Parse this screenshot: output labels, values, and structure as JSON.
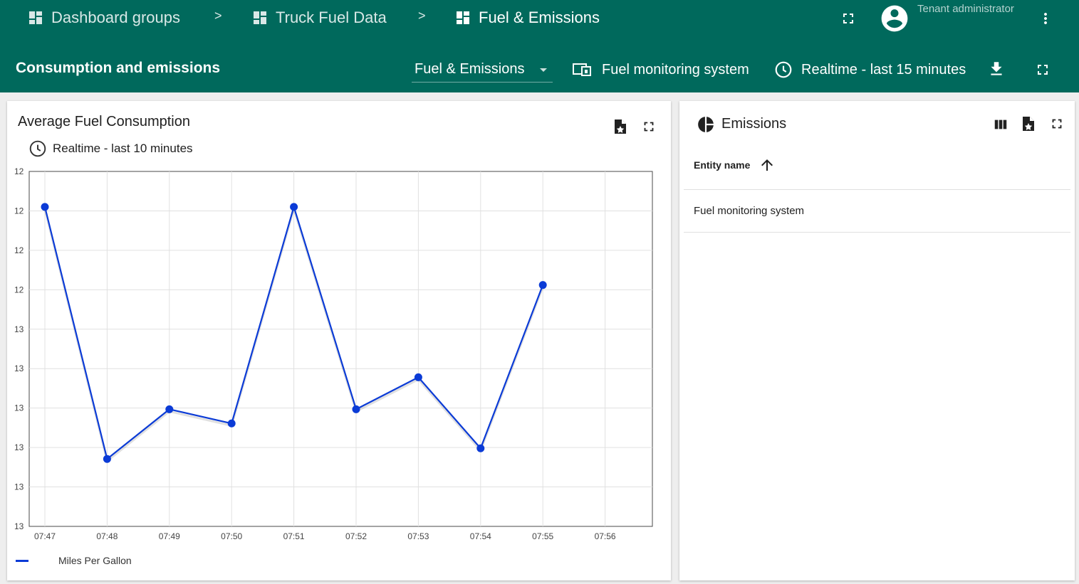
{
  "breadcrumbs": [
    {
      "label": "Dashboard groups"
    },
    {
      "label": "Truck Fuel Data"
    },
    {
      "label": "Fuel & Emissions"
    }
  ],
  "breadcrumb_separator": ">",
  "user": {
    "role": "Tenant administrator"
  },
  "dashboard": {
    "title": "Consumption and emissions",
    "state_select": "Fuel & Emissions",
    "entity_alias": "Fuel monitoring system",
    "timewindow": "Realtime - last 15 minutes"
  },
  "colors": {
    "header": "#00695c",
    "series": "#0b3bd6"
  },
  "widgets": {
    "fuel": {
      "title": "Average Fuel Consumption",
      "timewindow": "Realtime - last 10 minutes",
      "legend": "Miles Per Gallon"
    },
    "emissions": {
      "title": "Emissions",
      "column_header": "Entity name",
      "rows": [
        "Fuel monitoring system"
      ]
    }
  },
  "chart_data": {
    "type": "line",
    "x": [
      "07:47",
      "07:48",
      "07:49",
      "07:50",
      "07:51",
      "07:52",
      "07:53",
      "07:54",
      "07:55"
    ],
    "x_ticks": [
      "07:47",
      "07:48",
      "07:49",
      "07:50",
      "07:51",
      "07:52",
      "07:53",
      "07:54",
      "07:55",
      "07:56"
    ],
    "y_tick_labels": [
      "13",
      "13",
      "13",
      "13",
      "13",
      "13",
      "12",
      "12",
      "12",
      "12"
    ],
    "ylim": [
      12.0,
      13.0
    ],
    "series": [
      {
        "name": "Miles Per Gallon",
        "values": [
          12.9,
          12.19,
          12.33,
          12.29,
          12.9,
          12.33,
          12.42,
          12.22,
          12.68
        ]
      }
    ],
    "grid": true,
    "legend_position": "bottom-left"
  }
}
